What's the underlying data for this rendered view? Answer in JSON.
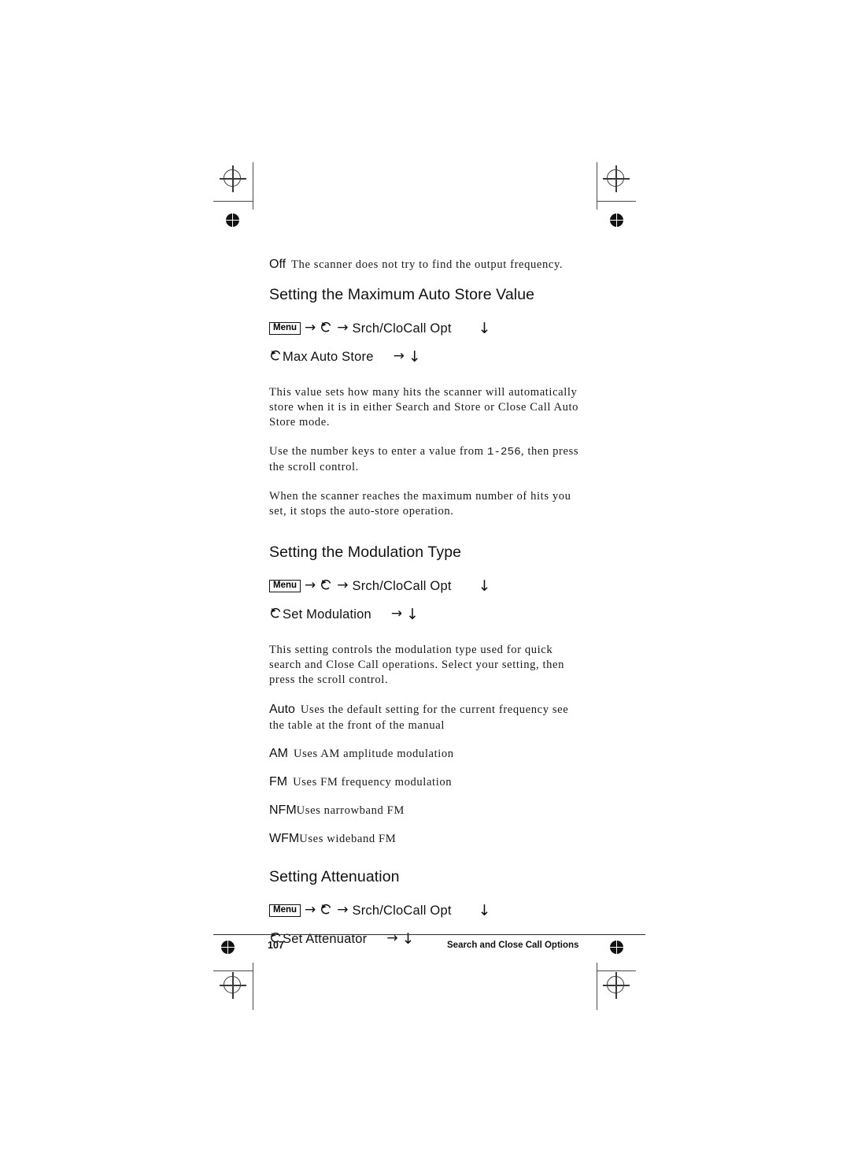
{
  "page": {
    "number": "107",
    "footer_title": "Search and Close Call Options"
  },
  "icons": {
    "menu_key": "Menu",
    "arrow_right": "→",
    "arrow_down": "↓"
  },
  "content": {
    "off_term": "Off",
    "off_desc": "The scanner does not try to find the output frequency.",
    "heading_max_auto_store": "Setting the Maximum Auto Store Value",
    "path1_label": "Srch/CloCall Opt",
    "path1b_label": "Max Auto Store",
    "para_max_1": "This value sets how many hits the scanner will automatically store when it is in either Search and Store or Close Call Auto Store mode.",
    "para_max_2_a": "Use the number keys to enter a value from ",
    "para_max_2_mono": "1-256",
    "para_max_2_b": ", then press the scroll control.",
    "para_max_3": "When the scanner reaches the maximum number of hits you set, it stops the auto-store operation.",
    "heading_modulation": "Setting the Modulation Type",
    "path2_label": "Srch/CloCall Opt",
    "path2b_label": "Set Modulation",
    "para_mod_1": "This setting controls the modulation type used for quick search and Close Call operations. Select your setting, then press the scroll control.",
    "def_auto_term": "Auto",
    "def_auto_desc": "Uses the default setting for the current frequency  see the table at the front of the manual",
    "def_am_term": "AM",
    "def_am_desc": "Uses AM  amplitude modulation",
    "def_fm_term": "FM",
    "def_fm_desc": "Uses FM  frequency modulation",
    "def_nfm_term": "NFM",
    "def_nfm_desc": "Uses narrowband FM",
    "def_wfm_term": "WFM",
    "def_wfm_desc": "Uses wideband FM",
    "heading_attenuation": "Setting Attenuation",
    "path3_label": "Srch/CloCall Opt",
    "path3b_label": "Set Attenuator"
  }
}
